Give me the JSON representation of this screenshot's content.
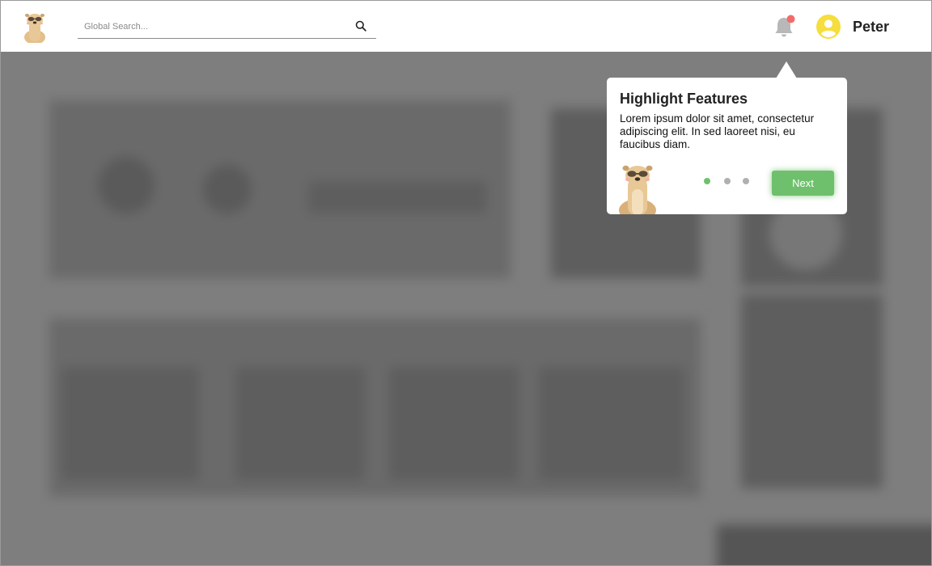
{
  "header": {
    "search_placeholder": "Global Search...",
    "user_name": "Peter",
    "notification_badge_color": "#f26b6b",
    "avatar_color": "#f5de3d"
  },
  "tooltip": {
    "title": "Highlight Features",
    "body": "Lorem ipsum dolor sit amet, consectetur adipiscing elit. In sed laoreet nisi, eu faucibus diam.",
    "next_label": "Next",
    "step_current": 1,
    "step_total": 3,
    "active_dot_color": "#6fc06c",
    "button_color": "#6fc06c"
  },
  "icons": [
    "meerkat-logo-icon",
    "search-icon",
    "bell-icon",
    "user-avatar-icon",
    "meerkat-mascot-icon"
  ]
}
